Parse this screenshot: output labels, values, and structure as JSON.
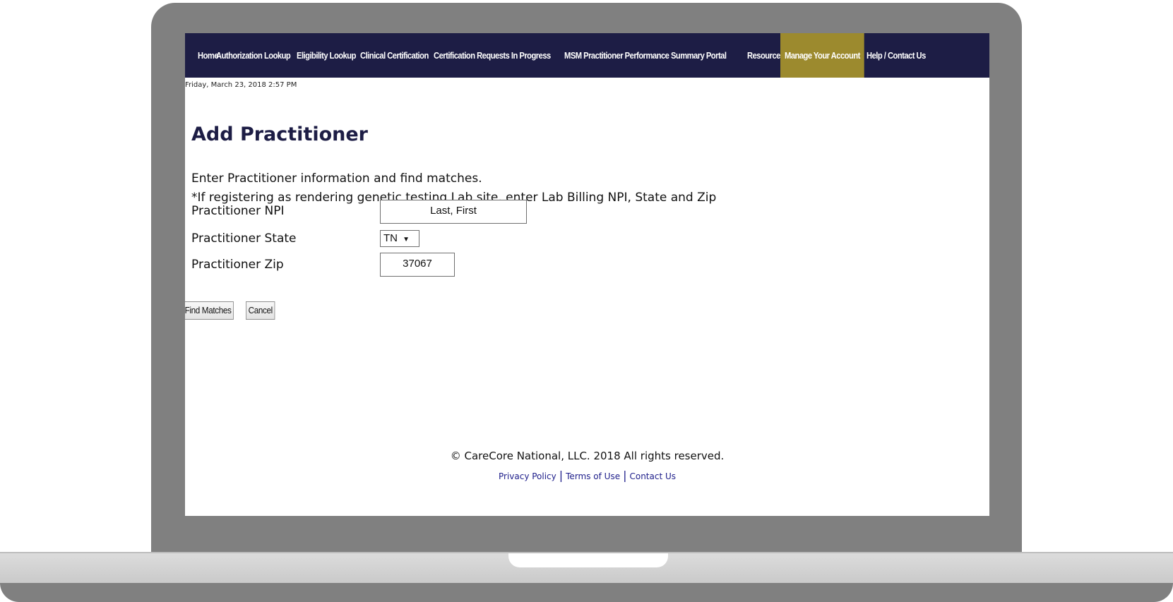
{
  "nav": {
    "items": [
      {
        "label": "Home"
      },
      {
        "label": "Authorization Lookup"
      },
      {
        "label": "Eligibility Lookup"
      },
      {
        "label": "Clinical Certification"
      },
      {
        "label": "Certification Requests In Progress"
      },
      {
        "label": "MSM Practitioner Performance Summary Portal"
      },
      {
        "label": "Resources"
      },
      {
        "label": "Manage Your Account"
      },
      {
        "label": "Help / Contact Us"
      }
    ],
    "active_color": "#9c8a2e",
    "bar_color": "#1d1d45"
  },
  "datetime": "Friday, March 23, 2018 2:57 PM",
  "page": {
    "title": "Add Practitioner",
    "intro_line1": "Enter Practitioner information and find matches.",
    "intro_line2": "*If registering as rendering genetic testing Lab site, enter Lab Billing NPI, State and Zip"
  },
  "form": {
    "npi_label": "Practitioner NPI",
    "npi_value": "Last, First",
    "state_label": "Practitioner State",
    "state_value": "TN",
    "zip_label": "Practitioner Zip",
    "zip_value": "37067"
  },
  "buttons": {
    "find_matches": "Find Matches",
    "cancel": "Cancel"
  },
  "footer": {
    "copyright": "© CareCore National, LLC. 2018 All rights reserved.",
    "privacy": "Privacy Policy",
    "terms": "Terms of Use",
    "contact": "Contact Us"
  }
}
